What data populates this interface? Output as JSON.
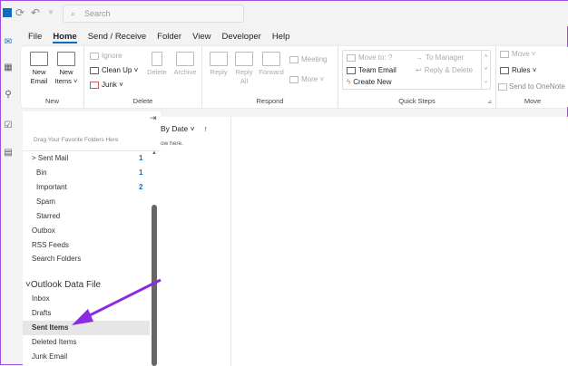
{
  "title_bar": {
    "search_placeholder": "Search"
  },
  "tabs": [
    "File",
    "Home",
    "Send / Receive",
    "Folder",
    "View",
    "Developer",
    "Help"
  ],
  "ribbon": {
    "new": {
      "label": "New",
      "new_email": "New Email",
      "new_items": "New Items ˅"
    },
    "delete": {
      "label": "Delete",
      "ignore": "Ignore",
      "clean_up": "Clean Up ˅",
      "junk": "Junk ˅",
      "delete": "Delete",
      "archive": "Archive"
    },
    "respond": {
      "label": "Respond",
      "reply": "Reply",
      "reply_all": "Reply All",
      "forward": "Forward",
      "meeting": "Meeting",
      "more": "More ˅"
    },
    "quick_steps": {
      "label": "Quick Steps",
      "move_to": "Move to: ?",
      "team_email": "Team Email",
      "create_new": "Create New",
      "to_manager": "To Manager",
      "reply_delete": "Reply & Delete"
    },
    "move": {
      "label": "Move",
      "move": "Move ˅",
      "rules": "Rules ˅",
      "send_onenote": "Send to OneNote"
    }
  },
  "folder_pane": {
    "favorites_hint": "Drag Your Favorite Folders Here",
    "folders": [
      {
        "name": "> Sent Mail",
        "count": "1"
      },
      {
        "name": "Bin",
        "count": "1"
      },
      {
        "name": "Important",
        "count": "2"
      },
      {
        "name": "Spam"
      },
      {
        "name": "Starred"
      },
      {
        "name": "Outbox"
      },
      {
        "name": "RSS Feeds"
      },
      {
        "name": "Search Folders"
      }
    ],
    "data_file": "Outlook Data File",
    "data_file_folders": [
      "Inbox",
      "Drafts",
      "Sent Items",
      "Deleted Items",
      "Junk Email"
    ]
  },
  "message_list": {
    "sort": "By Date ˅",
    "sort_dir": "↑",
    "empty": "ow here."
  },
  "colors": {
    "accent": "#0f6cbd",
    "annotation_arrow": "#8a2be2"
  }
}
